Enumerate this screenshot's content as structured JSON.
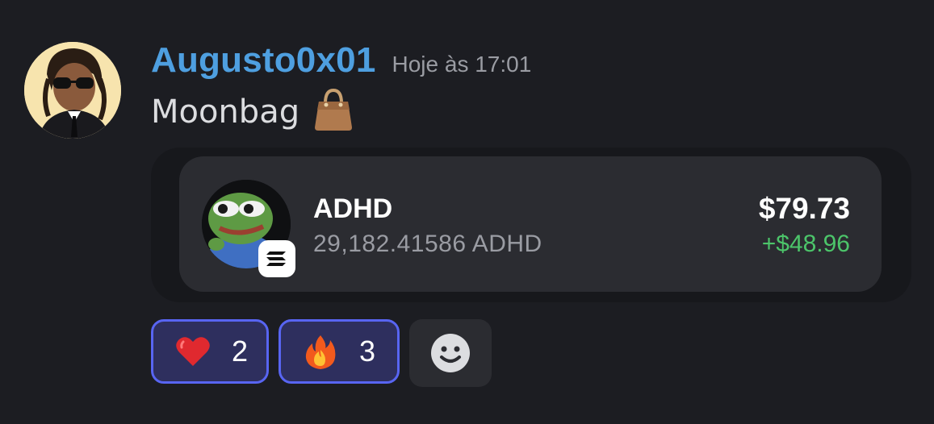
{
  "message": {
    "author": "Augusto0x01",
    "timestamp": "Hoje às 17:01",
    "text": "Moonbag",
    "emoji_icon": "handbag-icon",
    "avatar_icon": "user-avatar"
  },
  "token_card": {
    "symbol": "ADHD",
    "amount": "29,182.41586 ADHD",
    "value": "$79.73",
    "change": "+$48.96",
    "chain_icon": "solana-icon",
    "colors": {
      "change": "#4cc56a"
    }
  },
  "reactions": [
    {
      "emoji": "heart-icon",
      "count": "2",
      "selected": true
    },
    {
      "emoji": "fire-icon",
      "count": "3",
      "selected": true
    }
  ],
  "add_reaction": {
    "icon": "smiley-face-icon"
  },
  "colors": {
    "background": "#1c1d22",
    "username": "#4e9fe0",
    "reaction_border": "#5865f2",
    "reaction_bg": "#2e2f5e"
  }
}
